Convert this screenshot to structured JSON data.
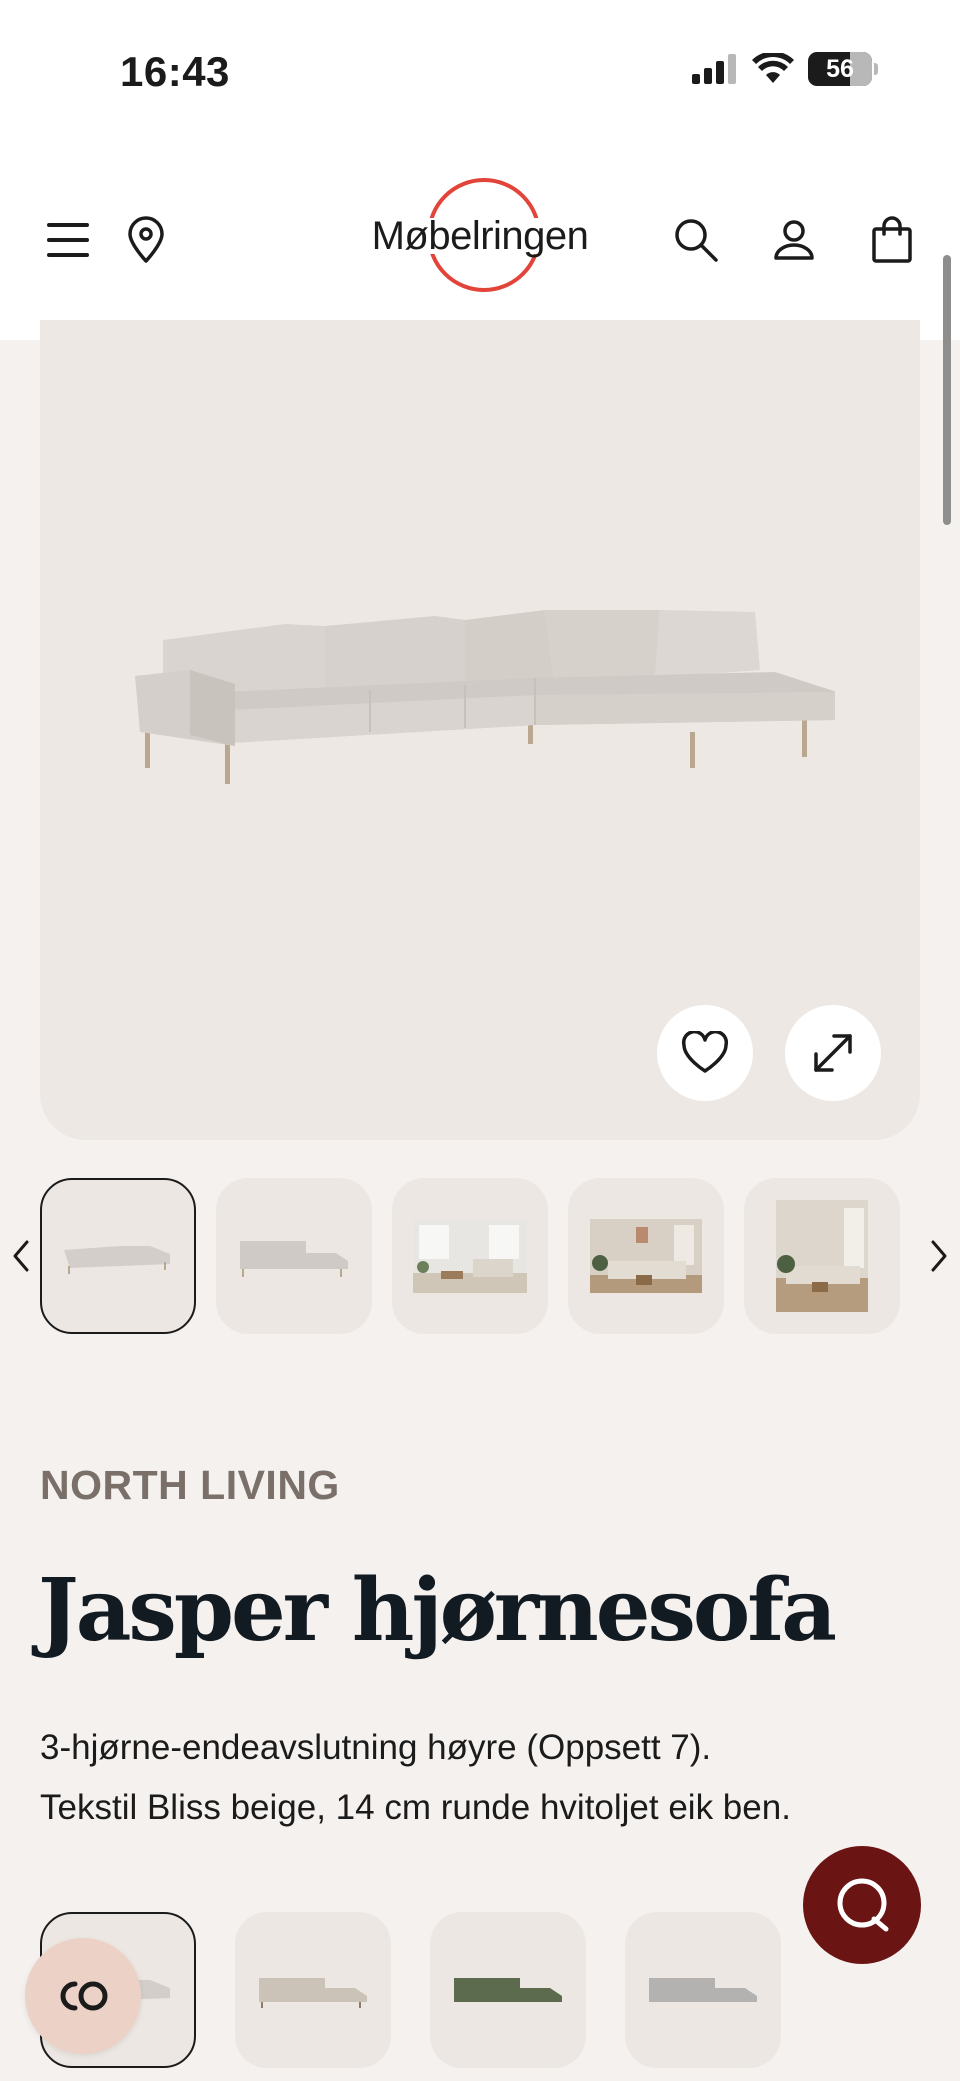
{
  "status_bar": {
    "time": "16:43",
    "battery": "56"
  },
  "header": {
    "logo_text": "Møbelringen",
    "icons": [
      "menu-icon",
      "location-pin-icon",
      "search-icon",
      "user-icon",
      "shopping-bag-icon"
    ]
  },
  "hero": {
    "favorite_icon": "heart-icon",
    "expand_icon": "expand-icon"
  },
  "product": {
    "brand": "NORTH LIVING",
    "title": "Jasper hjørnesofa",
    "description_line1": "3-hjørne-endeavslutning høyre (Oppsett 7).",
    "description_line2": "Tekstil Bliss beige, 14 cm runde hvitoljet eik ben."
  },
  "colors": {
    "accent_red": "#e2443a",
    "chat_button": "#6b1414",
    "page_bg": "#f4f1ee",
    "image_bg": "#ede8e3"
  }
}
